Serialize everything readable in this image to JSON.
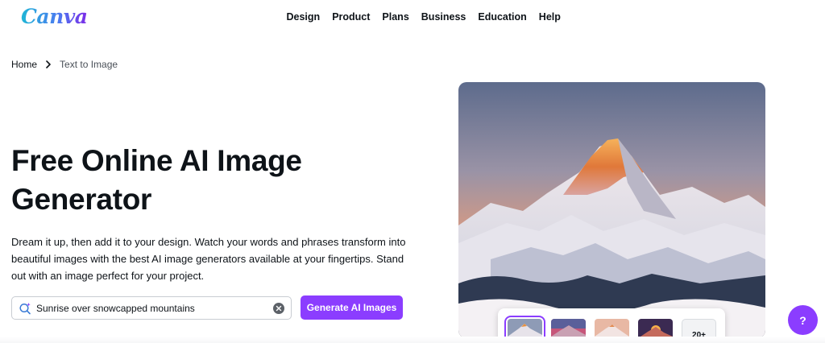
{
  "header": {
    "logo_text": "Canva",
    "nav": [
      "Design",
      "Product",
      "Plans",
      "Business",
      "Education",
      "Help"
    ]
  },
  "breadcrumb": {
    "home": "Home",
    "current": "Text to Image"
  },
  "hero": {
    "title": "Free Online AI Image Generator",
    "description": "Dream it up, then add it to your design. Watch your words and phrases transform into beautiful images with the best AI image generators available at your fingertips. Stand out with an image perfect for your project.",
    "search_value": "Sunrise over snowcapped mountains",
    "generate_label": "Generate AI Images"
  },
  "thumbnails": {
    "more_label": "20+"
  },
  "help_label": "?",
  "colors": {
    "accent": "#8b3dff",
    "text": "#0e1318"
  },
  "icons": {
    "breadcrumb_separator": "chevron-right-icon",
    "search": "ai-search-icon",
    "clear": "clear-icon"
  }
}
